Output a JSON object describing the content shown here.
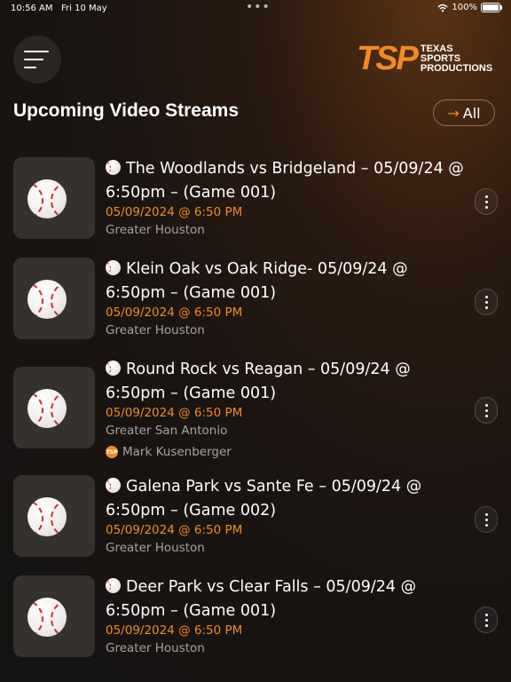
{
  "status_bar": {
    "time": "10:56 AM",
    "date": "Fri 10 May",
    "battery": "100%",
    "battery_level": 1.0
  },
  "header": {
    "logo_mark": "TSP",
    "logo_line1": "Texas",
    "logo_line2": "Sports",
    "logo_line3": "Productions"
  },
  "section": {
    "title": "Upcoming Video Streams",
    "all_label": "All",
    "all_icon": "arrow-right-icon"
  },
  "colors": {
    "accent": "#f18a21",
    "muted_text": "#a6a3a0"
  },
  "streams": [
    {
      "title": "The Woodlands vs Bridgeland – 05/09/24 @ 6:50pm – (Game 001)",
      "datetime": "05/09/2024 @ 6:50 PM",
      "region": "Greater Houston"
    },
    {
      "title": "Klein Oak vs Oak Ridge- 05/09/24 @ 6:50pm – (Game 001)",
      "datetime": "05/09/2024 @ 6:50 PM",
      "region": "Greater Houston"
    },
    {
      "title": "Round Rock vs Reagan – 05/09/24 @ 6:50pm – (Game 001)",
      "datetime": "05/09/2024 @ 6:50 PM",
      "region": "Greater San Antonio",
      "person": "Mark Kusenberger"
    },
    {
      "title": "Galena Park vs Sante Fe – 05/09/24 @ 6:50pm – (Game 002)",
      "datetime": "05/09/2024 @ 6:50 PM",
      "region": "Greater Houston"
    },
    {
      "title": "Deer Park vs Clear Falls – 05/09/24 @ 6:50pm – (Game 001)",
      "datetime": "05/09/2024 @ 6:50 PM",
      "region": "Greater Houston"
    }
  ]
}
